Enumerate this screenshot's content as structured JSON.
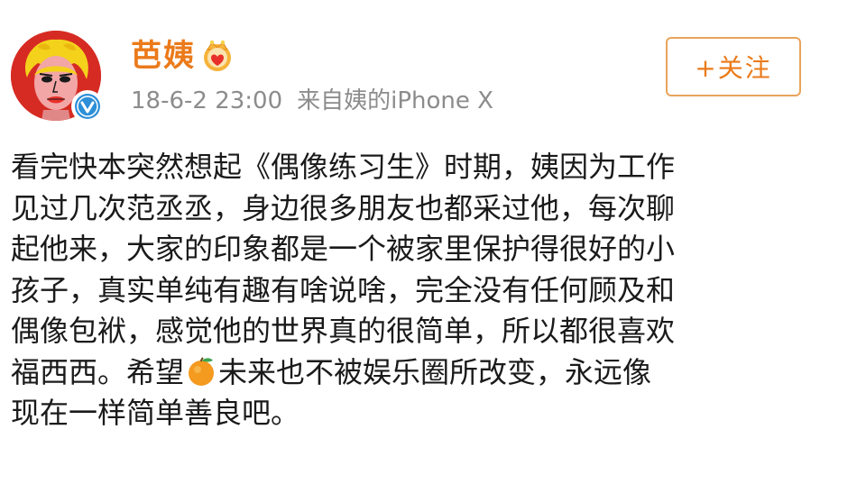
{
  "user": {
    "name": "芭姨",
    "badge_icon": "crown-badge-icon",
    "avatar_icon": "marilyn-avatar-icon",
    "verified_icon": "verified-v-icon"
  },
  "meta": {
    "timestamp": "18-6-2 23:00",
    "source": "来自姨的iPhone X"
  },
  "follow_button": {
    "label": "+关注"
  },
  "post": {
    "lines": [
      "看完快本突然想起《偶像练习生》时期，姨因为工作",
      "见过几次范丞丞，身边很多朋友也都采过他，每次聊",
      "起他来，大家的印象都是一个被家里保护得很好的小",
      "孩子，真实单纯有趣有啥说啥，完全没有任何顾及和",
      "偶像包袱，感觉他的世界真的很简单，所以都很喜欢"
    ],
    "line6_before": "福西西。希望",
    "emoji_icon": "orange-emoji-icon",
    "line6_after": "未来也不被娱乐圈所改变，永远像",
    "line7": "现在一样简单善良吧。"
  },
  "colors": {
    "accent": "#eb7a1a",
    "meta_gray": "#8c8c8c",
    "text": "#1a1a1a",
    "verified_blue": "#2d8fd8"
  }
}
